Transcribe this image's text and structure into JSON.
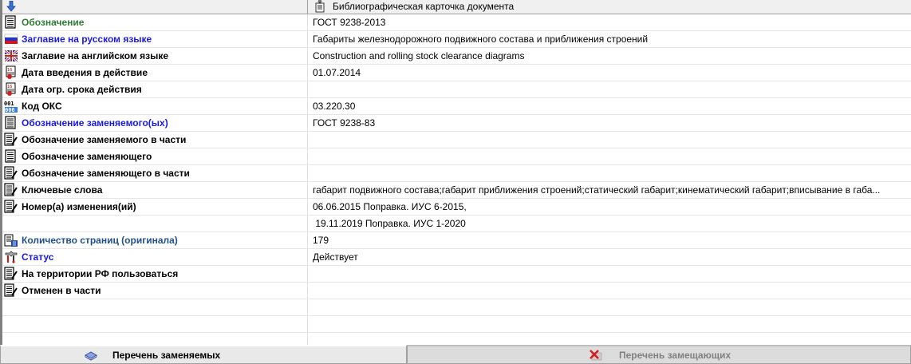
{
  "header": {
    "right_title": "Библиографическая карточка документа"
  },
  "rows": [
    {
      "label": "Обозначение",
      "value": "ГОСТ 9238-2013",
      "icon": "document-lines-icon"
    },
    {
      "label": "Заглавие на русском языке",
      "value": "Габариты железнодорожного подвижного состава и приближения строений",
      "icon": "russian-flag-icon"
    },
    {
      "label": "Заглавие на английском языке",
      "value": "Construction and rolling stock clearance diagrams",
      "icon": "uk-flag-icon"
    },
    {
      "label": "Дата введения в действие",
      "value": "01.07.2014",
      "icon": "calendar-icon"
    },
    {
      "label": "Дата огр. срока действия",
      "value": "",
      "icon": "calendar-icon"
    },
    {
      "label": "Код ОКС",
      "value": "03.220.30",
      "icon": "code-icon"
    },
    {
      "label": "Обозначение заменяемого(ых)",
      "value": "ГОСТ 9238-83",
      "icon": "document-lines-icon"
    },
    {
      "label": "Обозначение заменяемого в части",
      "value": "",
      "icon": "document-pen-icon"
    },
    {
      "label": "Обозначение заменяющего",
      "value": "",
      "icon": "document-lines-icon"
    },
    {
      "label": "Обозначение заменяющего в части",
      "value": "",
      "icon": "document-pen-icon"
    },
    {
      "label": "Ключевые слова",
      "value": "габарит подвижного состава;габарит приближения строений;статический габарит;кинематический габарит;вписывание в габа...",
      "icon": "document-pen-icon"
    },
    {
      "label": "Номер(а) изменения(ий)",
      "value": "06.06.2015 Поправка. ИУС 6-2015,",
      "icon": "document-pen-icon"
    },
    {
      "label": "",
      "value": " 19.11.2019 Поправка. ИУС 1-2020",
      "icon": ""
    },
    {
      "label": "Количество страниц (оригинала)",
      "value": "179",
      "icon": "pages-count-icon"
    },
    {
      "label": "Статус",
      "value": "Действует",
      "icon": "tools-icon"
    },
    {
      "label": "На территории РФ пользоваться",
      "value": "",
      "icon": "document-pen-icon"
    },
    {
      "label": "Отменен в части",
      "value": "",
      "icon": "document-pen-icon"
    },
    {
      "label": "",
      "value": "",
      "icon": ""
    },
    {
      "label": "",
      "value": "",
      "icon": ""
    },
    {
      "label": "",
      "value": "",
      "icon": ""
    }
  ],
  "buttons": {
    "replaced_list": "Перечень заменяемых",
    "replacing_list": "Перечень замещающих"
  }
}
